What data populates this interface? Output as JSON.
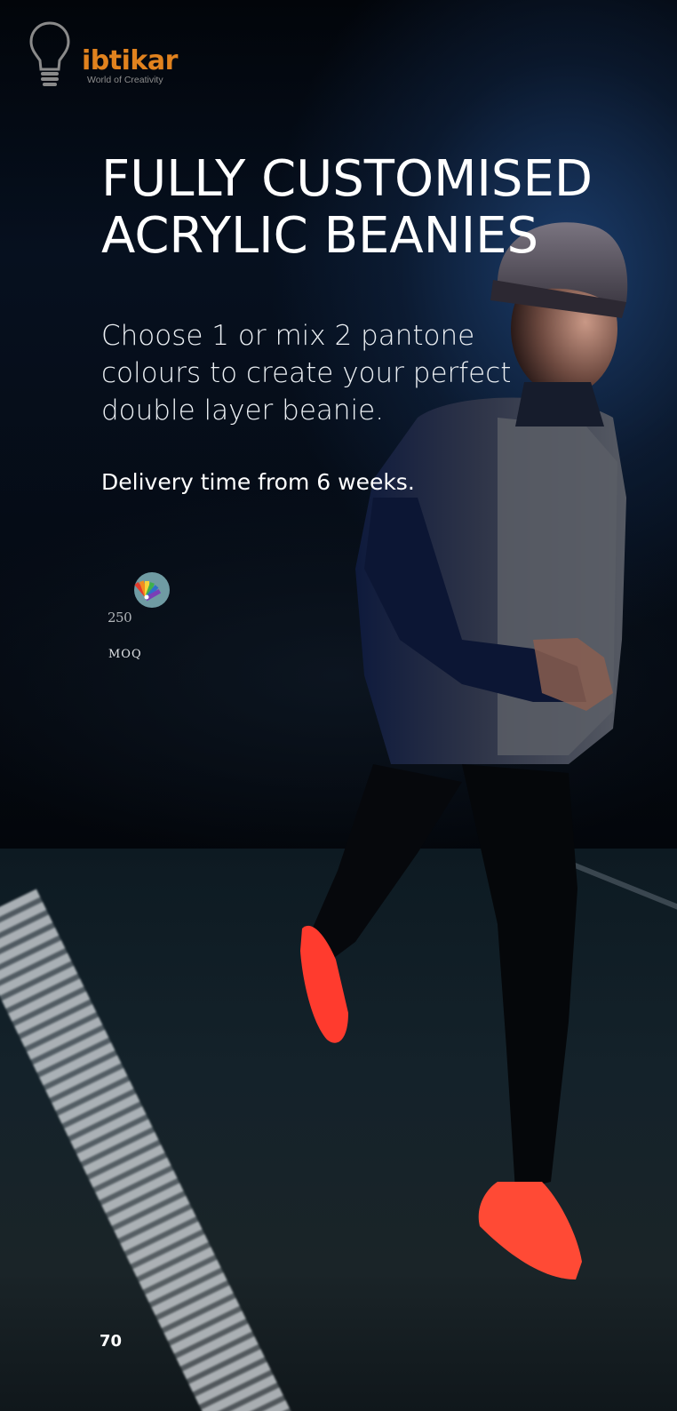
{
  "logo": {
    "name": "ibtikar",
    "tagline": "World of Creativity",
    "colors": {
      "brand": "#e1821e",
      "bulb": "#8a8a8a"
    }
  },
  "headline": {
    "line1": "FULLY CUSTOMISED",
    "line2": "ACRYLIC BEANIES"
  },
  "description": "Choose 1 or mix 2 pantone colours to create your perfect double layer beanie.",
  "delivery": "Delivery time from 6 weeks.",
  "moq": {
    "icon": "color-swatch-fan-icon",
    "value": "250",
    "label": "MOQ"
  },
  "page_number": "70",
  "photo": {
    "icon": "runner-photo",
    "colors": {
      "sky": "#0b1f3d",
      "road": "#1a2428",
      "shoes": "#ff3b2e"
    }
  }
}
